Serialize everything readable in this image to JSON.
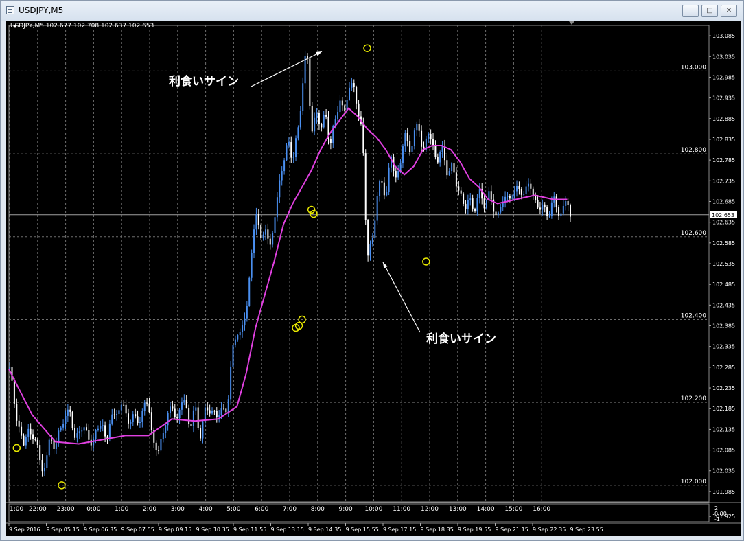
{
  "window": {
    "title": "USDJPY,M5"
  },
  "info_line": "USDJPY,M5  102.677 102.708 102.637 102.653",
  "annotations": [
    "利食いサイン",
    "利食いサイン"
  ],
  "colors": {
    "background": "#000000",
    "bull": "#4a8ff0",
    "bear": "#ffffff",
    "ma": "#e040e0",
    "marker": "#e8e800",
    "grid": "#6e6e6e"
  },
  "chart_data": {
    "type": "candlestick",
    "symbol": "USDJPY",
    "timeframe": "M5",
    "ylim": [
      101.96,
      103.11
    ],
    "current_price": "102.653",
    "price_labels_major": [
      "103.000",
      "102.800",
      "102.600",
      "102.400",
      "102.200",
      "102.000"
    ],
    "price_labels_minor": [
      "103.085",
      "103.035",
      "102.985",
      "102.935",
      "102.885",
      "102.835",
      "102.785",
      "102.735",
      "102.685",
      "102.635",
      "102.585",
      "102.535",
      "102.485",
      "102.435",
      "102.385",
      "102.335",
      "102.285",
      "102.235",
      "102.185",
      "102.135",
      "102.085",
      "102.035",
      "101.985",
      "101.925"
    ],
    "time_labels_top": [
      "1:00",
      "22:00",
      "23:00",
      "0:00",
      "1:00",
      "2:00",
      "3:00",
      "4:00",
      "5:00",
      "6:00",
      "7:00",
      "8:00",
      "9:00",
      "10:00",
      "11:00",
      "12:00",
      "13:00",
      "14:00",
      "15:00",
      "16:00"
    ],
    "time_labels_bottom": [
      "9 Sep 2016",
      "9 Sep 05:15",
      "9 Sep 06:35",
      "9 Sep 07:55",
      "9 Sep 09:15",
      "9 Sep 10:35",
      "9 Sep 11:55",
      "9 Sep 13:15",
      "9 Sep 14:35",
      "9 Sep 15:55",
      "9 Sep 17:15",
      "9 Sep 18:35",
      "9 Sep 19:55",
      "9 Sep 21:15",
      "9 Sep 22:35",
      "9 Sep 23:55"
    ],
    "sub_scale": [
      "2",
      "0.00",
      "-1"
    ],
    "price_path": [
      [
        0,
        102.28
      ],
      [
        6,
        102.22
      ],
      [
        12,
        102.15
      ],
      [
        18,
        102.08
      ],
      [
        24,
        102.15
      ],
      [
        30,
        102.11
      ],
      [
        36,
        102.1
      ],
      [
        42,
        102.05
      ],
      [
        48,
        102.04
      ],
      [
        54,
        102.13
      ],
      [
        60,
        102.09
      ],
      [
        66,
        102.13
      ],
      [
        72,
        102.17
      ],
      [
        78,
        102.19
      ],
      [
        84,
        102.1
      ],
      [
        90,
        102.15
      ],
      [
        96,
        102.12
      ],
      [
        102,
        102.13
      ],
      [
        108,
        102.1
      ],
      [
        114,
        102.13
      ],
      [
        120,
        102.16
      ],
      [
        126,
        102.1
      ],
      [
        132,
        102.16
      ],
      [
        138,
        102.19
      ],
      [
        144,
        102.17
      ],
      [
        150,
        102.2
      ],
      [
        156,
        102.14
      ],
      [
        162,
        102.17
      ],
      [
        168,
        102.15
      ],
      [
        174,
        102.2
      ],
      [
        180,
        102.18
      ],
      [
        186,
        102.13
      ],
      [
        192,
        102.05
      ],
      [
        198,
        102.14
      ],
      [
        204,
        102.16
      ],
      [
        210,
        102.19
      ],
      [
        216,
        102.16
      ],
      [
        222,
        102.2
      ],
      [
        228,
        102.19
      ],
      [
        234,
        102.15
      ],
      [
        240,
        102.18
      ],
      [
        246,
        102.12
      ],
      [
        252,
        102.18
      ],
      [
        258,
        102.17
      ],
      [
        264,
        102.19
      ],
      [
        270,
        102.16
      ],
      [
        276,
        102.18
      ],
      [
        282,
        102.2
      ],
      [
        288,
        102.31
      ],
      [
        294,
        102.38
      ],
      [
        300,
        102.37
      ],
      [
        306,
        102.41
      ],
      [
        312,
        102.55
      ],
      [
        318,
        102.66
      ],
      [
        324,
        102.59
      ],
      [
        330,
        102.64
      ],
      [
        336,
        102.55
      ],
      [
        342,
        102.65
      ],
      [
        348,
        102.72
      ],
      [
        354,
        102.77
      ],
      [
        360,
        102.85
      ],
      [
        366,
        102.77
      ],
      [
        372,
        102.85
      ],
      [
        378,
        102.96
      ],
      [
        384,
        103.05
      ],
      [
        390,
        102.86
      ],
      [
        396,
        102.9
      ],
      [
        402,
        102.85
      ],
      [
        408,
        102.92
      ],
      [
        414,
        102.8
      ],
      [
        420,
        102.88
      ],
      [
        426,
        102.94
      ],
      [
        432,
        102.88
      ],
      [
        438,
        102.97
      ],
      [
        444,
        102.97
      ],
      [
        450,
        102.89
      ],
      [
        456,
        102.87
      ],
      [
        462,
        102.53
      ],
      [
        468,
        102.59
      ],
      [
        474,
        102.69
      ],
      [
        480,
        102.73
      ],
      [
        486,
        102.7
      ],
      [
        492,
        102.8
      ],
      [
        498,
        102.73
      ],
      [
        504,
        102.78
      ],
      [
        510,
        102.84
      ],
      [
        516,
        102.81
      ],
      [
        522,
        102.85
      ],
      [
        528,
        102.86
      ],
      [
        534,
        102.81
      ],
      [
        540,
        102.85
      ],
      [
        546,
        102.82
      ],
      [
        552,
        102.79
      ],
      [
        558,
        102.81
      ],
      [
        564,
        102.76
      ],
      [
        570,
        102.78
      ],
      [
        576,
        102.72
      ],
      [
        582,
        102.72
      ],
      [
        588,
        102.66
      ],
      [
        594,
        102.69
      ],
      [
        600,
        102.67
      ],
      [
        606,
        102.7
      ],
      [
        612,
        102.68
      ],
      [
        618,
        102.71
      ],
      [
        624,
        102.66
      ],
      [
        630,
        102.66
      ],
      [
        636,
        102.68
      ],
      [
        642,
        102.69
      ],
      [
        648,
        102.71
      ],
      [
        654,
        102.7
      ],
      [
        660,
        102.72
      ],
      [
        666,
        102.71
      ],
      [
        672,
        102.72
      ],
      [
        678,
        102.7
      ],
      [
        684,
        102.66
      ],
      [
        690,
        102.67
      ],
      [
        696,
        102.66
      ],
      [
        702,
        102.68
      ],
      [
        708,
        102.67
      ],
      [
        714,
        102.66
      ],
      [
        720,
        102.685
      ],
      [
        724,
        102.653
      ]
    ],
    "ma_path": [
      [
        0,
        102.28
      ],
      [
        30,
        102.17
      ],
      [
        60,
        102.105
      ],
      [
        90,
        102.1
      ],
      [
        120,
        102.11
      ],
      [
        150,
        102.12
      ],
      [
        180,
        102.12
      ],
      [
        210,
        102.16
      ],
      [
        240,
        102.155
      ],
      [
        270,
        102.16
      ],
      [
        294,
        102.19
      ],
      [
        306,
        102.27
      ],
      [
        318,
        102.38
      ],
      [
        330,
        102.46
      ],
      [
        342,
        102.54
      ],
      [
        354,
        102.63
      ],
      [
        366,
        102.68
      ],
      [
        378,
        102.72
      ],
      [
        390,
        102.76
      ],
      [
        402,
        102.81
      ],
      [
        414,
        102.85
      ],
      [
        426,
        102.88
      ],
      [
        438,
        102.91
      ],
      [
        450,
        102.89
      ],
      [
        462,
        102.86
      ],
      [
        474,
        102.84
      ],
      [
        486,
        102.81
      ],
      [
        498,
        102.77
      ],
      [
        510,
        102.75
      ],
      [
        522,
        102.77
      ],
      [
        534,
        102.81
      ],
      [
        546,
        102.82
      ],
      [
        558,
        102.82
      ],
      [
        570,
        102.81
      ],
      [
        582,
        102.78
      ],
      [
        594,
        102.74
      ],
      [
        606,
        102.72
      ],
      [
        618,
        102.69
      ],
      [
        630,
        102.68
      ],
      [
        642,
        102.685
      ],
      [
        654,
        102.69
      ],
      [
        666,
        102.695
      ],
      [
        678,
        102.7
      ],
      [
        690,
        102.695
      ],
      [
        702,
        102.69
      ],
      [
        714,
        102.69
      ],
      [
        720,
        102.69
      ]
    ],
    "signal_markers": [
      [
        10,
        102.09
      ],
      [
        68,
        102.0
      ],
      [
        370,
        102.38
      ],
      [
        374,
        102.385
      ],
      [
        378,
        102.4
      ],
      [
        390,
        102.665
      ],
      [
        393,
        102.655
      ],
      [
        462,
        103.055
      ],
      [
        538,
        102.54
      ]
    ]
  }
}
